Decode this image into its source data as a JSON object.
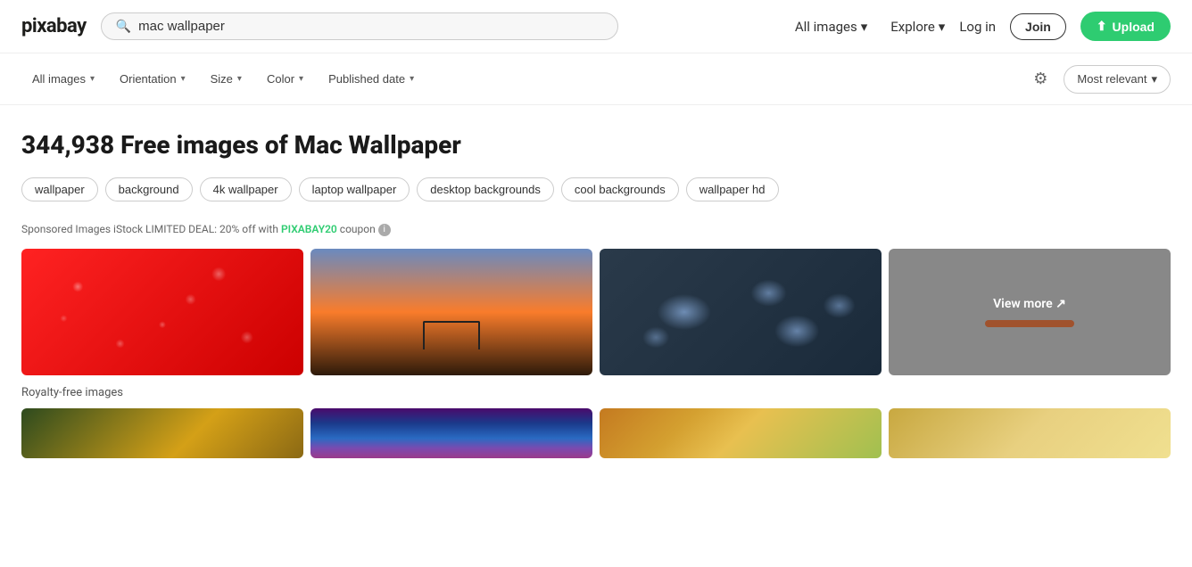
{
  "logo": {
    "text": "pixabay"
  },
  "header": {
    "search_placeholder": "mac wallpaper",
    "search_value": "mac wallpaper",
    "all_images_label": "All images",
    "explore_label": "Explore",
    "login_label": "Log in",
    "join_label": "Join",
    "upload_label": "Upload"
  },
  "filters": {
    "all_images": "All images",
    "orientation": "Orientation",
    "size": "Size",
    "color": "Color",
    "published_date": "Published date",
    "sort": "Most relevant"
  },
  "main": {
    "title": "344,938 Free images of Mac Wallpaper",
    "sponsored_text": "Sponsored Images iStock LIMITED DEAL: 20% off with",
    "sponsored_code": "PIXABAY20",
    "sponsored_suffix": "coupon",
    "royalty_free_label": "Royalty-free images"
  },
  "tags": [
    {
      "label": "wallpaper"
    },
    {
      "label": "background"
    },
    {
      "label": "4k wallpaper"
    },
    {
      "label": "laptop wallpaper"
    },
    {
      "label": "desktop backgrounds"
    },
    {
      "label": "cool backgrounds"
    },
    {
      "label": "wallpaper hd"
    }
  ],
  "sponsored_images": [
    {
      "alt": "red water drops"
    },
    {
      "alt": "jeep at sunset"
    },
    {
      "alt": "water drops on dark surface"
    },
    {
      "alt": "view more"
    }
  ],
  "royalty_free_images": [
    {
      "alt": "nature gold"
    },
    {
      "alt": "storm clouds"
    },
    {
      "alt": "blur warm colors"
    },
    {
      "alt": "wheat"
    }
  ],
  "icons": {
    "search": "🔍",
    "chevron_down": "▾",
    "gear": "⚙",
    "upload": "⬆",
    "info": "i",
    "view_more": "View more ↗"
  }
}
